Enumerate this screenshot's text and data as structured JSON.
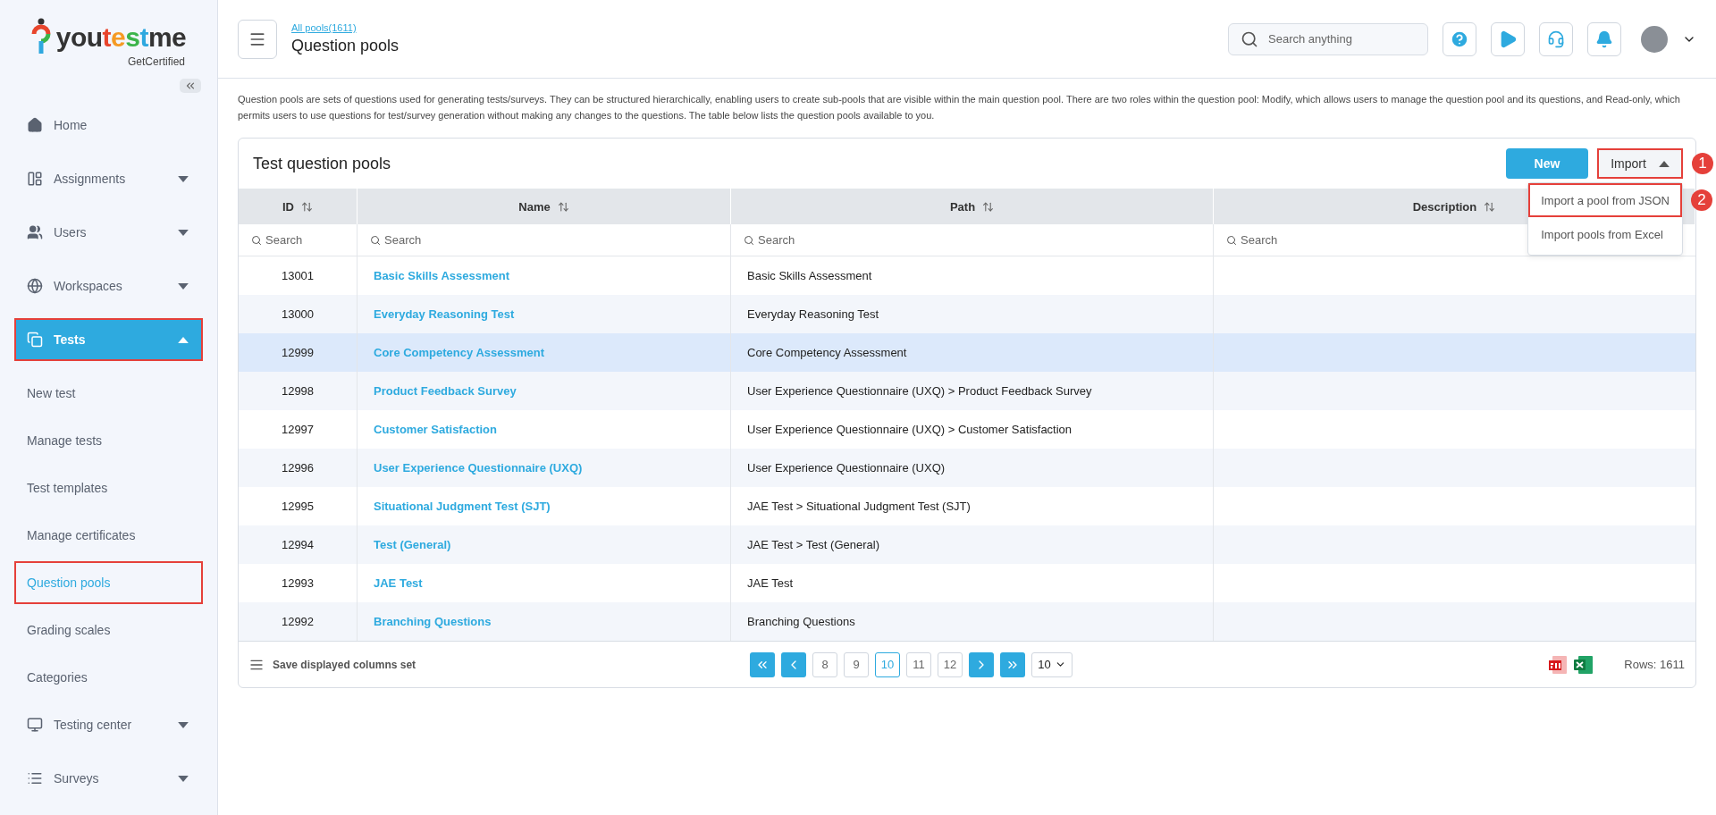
{
  "logo": {
    "wordmark": [
      {
        "text": "you",
        "color": "#333333"
      },
      {
        "text": "t",
        "color": "#e8452c"
      },
      {
        "text": "e",
        "color": "#f59a23"
      },
      {
        "text": "s",
        "color": "#3cb44a"
      },
      {
        "text": "t",
        "color": "#2ea8df"
      },
      {
        "text": "me",
        "color": "#333333"
      }
    ],
    "tagline": "GetCertified"
  },
  "sidebar": {
    "items": [
      {
        "label": "Home",
        "kind": "link",
        "selected": false,
        "outlined": false
      },
      {
        "label": "Assignments",
        "kind": "group",
        "expanded": false,
        "selected": false,
        "outlined": false
      },
      {
        "label": "Users",
        "kind": "group",
        "expanded": false,
        "selected": false,
        "outlined": false
      },
      {
        "label": "Workspaces",
        "kind": "group",
        "expanded": false,
        "selected": false,
        "outlined": false
      },
      {
        "label": "Tests",
        "kind": "group",
        "expanded": true,
        "selected": true,
        "outlined": true,
        "children": [
          {
            "label": "New test",
            "selected": false,
            "outlined": false
          },
          {
            "label": "Manage tests",
            "selected": false,
            "outlined": false
          },
          {
            "label": "Test templates",
            "selected": false,
            "outlined": false
          },
          {
            "label": "Manage certificates",
            "selected": false,
            "outlined": false
          },
          {
            "label": "Question pools",
            "selected": true,
            "outlined": true
          },
          {
            "label": "Grading scales",
            "selected": false,
            "outlined": false
          },
          {
            "label": "Categories",
            "selected": false,
            "outlined": false
          }
        ]
      },
      {
        "label": "Testing center",
        "kind": "group",
        "expanded": false,
        "selected": false,
        "outlined": false
      },
      {
        "label": "Surveys",
        "kind": "group",
        "expanded": false,
        "selected": false,
        "outlined": false
      }
    ]
  },
  "header": {
    "breadcrumb": "All pools(1611)",
    "title": "Question pools",
    "search": {
      "placeholder": "Search anything"
    }
  },
  "description": "Question pools are sets of questions used for generating tests/surveys. They can be structured hierarchically, enabling users to create sub-pools that are visible within the main question pool. There are two roles within the question pool: Modify, which allows users to manage the question pool and its questions, and Read-only, which permits users to use questions for test/survey generation without making any changes to the questions. The table below lists the question pools available to you.",
  "card": {
    "title": "Test question pools",
    "new_button": "New",
    "import_button": {
      "label": "Import",
      "expanded": true,
      "outlined": true,
      "callout": "1"
    },
    "import_menu": [
      {
        "label": "Import a pool from JSON",
        "outlined": true,
        "callout": "2"
      },
      {
        "label": "Import pools from Excel",
        "outlined": false
      }
    ],
    "columns": [
      {
        "label": "ID",
        "placeholder": "Search"
      },
      {
        "label": "Name",
        "placeholder": "Search"
      },
      {
        "label": "Path",
        "placeholder": "Search"
      },
      {
        "label": "Description",
        "placeholder": "Search"
      }
    ],
    "rows": [
      {
        "id": "13001",
        "name": "Basic Skills Assessment",
        "path": "Basic Skills Assessment",
        "selected": false
      },
      {
        "id": "13000",
        "name": "Everyday Reasoning Test",
        "path": "Everyday Reasoning Test",
        "selected": false
      },
      {
        "id": "12999",
        "name": "Core Competency Assessment",
        "path": "Core Competency Assessment",
        "selected": true
      },
      {
        "id": "12998",
        "name": "Product Feedback Survey",
        "path": "User Experience Questionnaire (UXQ) > Product Feedback Survey",
        "selected": false
      },
      {
        "id": "12997",
        "name": "Customer Satisfaction",
        "path": "User Experience Questionnaire (UXQ) > Customer Satisfaction",
        "selected": false
      },
      {
        "id": "12996",
        "name": "User Experience Questionnaire (UXQ)",
        "path": "User Experience Questionnaire (UXQ)",
        "selected": false
      },
      {
        "id": "12995",
        "name": "Situational Judgment Test (SJT)",
        "path": "JAE Test > Situational Judgment Test (SJT)",
        "selected": false
      },
      {
        "id": "12994",
        "name": "Test (General)",
        "path": "JAE Test > Test (General)",
        "selected": false
      },
      {
        "id": "12993",
        "name": "JAE Test",
        "path": "JAE Test",
        "selected": false
      },
      {
        "id": "12992",
        "name": "Branching Questions",
        "path": "Branching Questions",
        "selected": false
      }
    ],
    "footer": {
      "save_columns": "Save displayed columns set",
      "pages": [
        {
          "label": "8",
          "selected": false
        },
        {
          "label": "9",
          "selected": false
        },
        {
          "label": "10",
          "selected": true
        },
        {
          "label": "11",
          "selected": false
        },
        {
          "label": "12",
          "selected": false
        }
      ],
      "page_size": "10",
      "rows_count": "Rows: 1611"
    }
  }
}
